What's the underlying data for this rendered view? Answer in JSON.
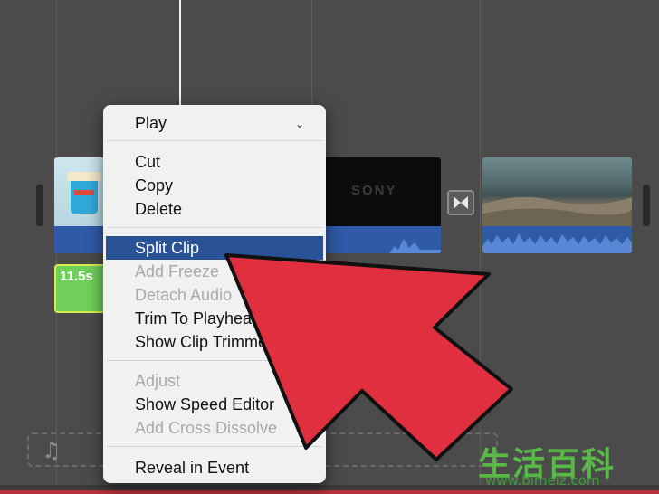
{
  "context_menu": {
    "items": [
      {
        "label": "Play",
        "enabled": true
      },
      {
        "label": "Cut",
        "enabled": true
      },
      {
        "label": "Copy",
        "enabled": true
      },
      {
        "label": "Delete",
        "enabled": true
      },
      {
        "label": "Split Clip",
        "enabled": true,
        "selected": true
      },
      {
        "label": "Add Freeze",
        "enabled": false
      },
      {
        "label": "Detach Audio",
        "enabled": false
      },
      {
        "label": "Trim To Playhea",
        "enabled": true
      },
      {
        "label": "Show Clip Trimme",
        "enabled": true
      },
      {
        "label": "Adjust",
        "enabled": false
      },
      {
        "label": "Show Speed Editor",
        "enabled": true
      },
      {
        "label": "Add Cross Dissolve",
        "enabled": false
      },
      {
        "label": "Reveal in Event",
        "enabled": true
      }
    ]
  },
  "timeline": {
    "sony_clip_text": "SONY",
    "green_clip_label": "11.5s",
    "music_icon": "music-note-icon",
    "transition_icon": "bowtie-transition-icon"
  },
  "overlay": {
    "arrow_color": "#e0303f",
    "arrow_icon": "large-pointer-arrow"
  },
  "watermark": {
    "chars": "生活百科",
    "url": "www.bimeiz.com"
  },
  "colors": {
    "menu_highlight": "#2a5296",
    "menu_bg": "#f1f1f1",
    "audio_blue": "#2f5aa8",
    "green_clip": "#6fcf5a"
  }
}
